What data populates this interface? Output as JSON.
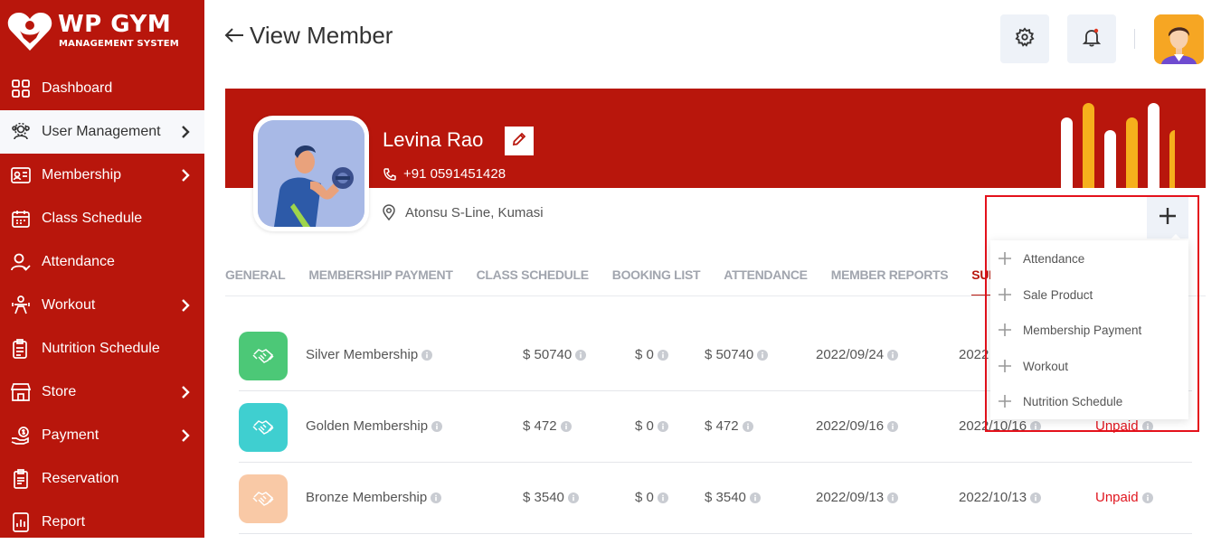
{
  "brand": {
    "name": "WP GYM",
    "tagline": "MANAGEMENT SYSTEM"
  },
  "sidebar": {
    "items": [
      {
        "label": "Dashboard",
        "icon": "dashboard-grid-icon",
        "has_children": false,
        "active": false
      },
      {
        "label": "User Management",
        "icon": "users-gear-icon",
        "has_children": true,
        "active": true
      },
      {
        "label": "Membership",
        "icon": "membership-card-icon",
        "has_children": true,
        "active": false
      },
      {
        "label": "Class Schedule",
        "icon": "calendar-icon",
        "has_children": false,
        "active": false
      },
      {
        "label": "Attendance",
        "icon": "user-check-icon",
        "has_children": false,
        "active": false
      },
      {
        "label": "Workout",
        "icon": "workout-icon",
        "has_children": true,
        "active": false
      },
      {
        "label": "Nutrition Schedule",
        "icon": "nutrition-icon",
        "has_children": false,
        "active": false
      },
      {
        "label": "Store",
        "icon": "store-icon",
        "has_children": true,
        "active": false
      },
      {
        "label": "Payment",
        "icon": "payment-icon",
        "has_children": true,
        "active": false
      },
      {
        "label": "Reservation",
        "icon": "reservation-icon",
        "has_children": false,
        "active": false
      },
      {
        "label": "Report",
        "icon": "report-icon",
        "has_children": false,
        "active": false
      }
    ]
  },
  "header": {
    "title": "View Member"
  },
  "member": {
    "name": "Levina Rao",
    "phone": "+91  0591451428",
    "address": "Atonsu S-Line, Kumasi"
  },
  "tabs": [
    {
      "label": "GENERAL",
      "active": false
    },
    {
      "label": "MEMBERSHIP PAYMENT",
      "active": false
    },
    {
      "label": "CLASS SCHEDULE",
      "active": false
    },
    {
      "label": "BOOKING LIST",
      "active": false
    },
    {
      "label": "ATTENDANCE",
      "active": false
    },
    {
      "label": "MEMBER REPORTS",
      "active": false
    },
    {
      "label": "SUBSCRIP",
      "active": true
    }
  ],
  "subscriptions": [
    {
      "plan": "Silver Membership",
      "amount": "$ 50740",
      "paid": "$ 0",
      "due": "$ 50740",
      "start": "2022/09/24",
      "end": "2022",
      "status": "",
      "tile_color": "#4cc877"
    },
    {
      "plan": "Golden Membership",
      "amount": "$ 472",
      "paid": "$ 0",
      "due": "$ 472",
      "start": "2022/09/16",
      "end": "2022/10/16",
      "status": "Unpaid",
      "tile_color": "#3fcfd0"
    },
    {
      "plan": "Bronze Membership",
      "amount": "$ 3540",
      "paid": "$ 0",
      "due": "$ 3540",
      "start": "2022/09/13",
      "end": "2022/10/13",
      "status": "Unpaid",
      "tile_color": "#f9c9a6"
    }
  ],
  "add_menu": {
    "items": [
      "Attendance",
      "Sale Product",
      "Membership Payment",
      "Workout",
      "Nutrition Schedule"
    ]
  },
  "colors": {
    "brand_red": "#b8160c",
    "accent_yellow": "#f6b01c",
    "unpaid_red": "#e0161f",
    "highlight_frame": "#e4111b"
  }
}
